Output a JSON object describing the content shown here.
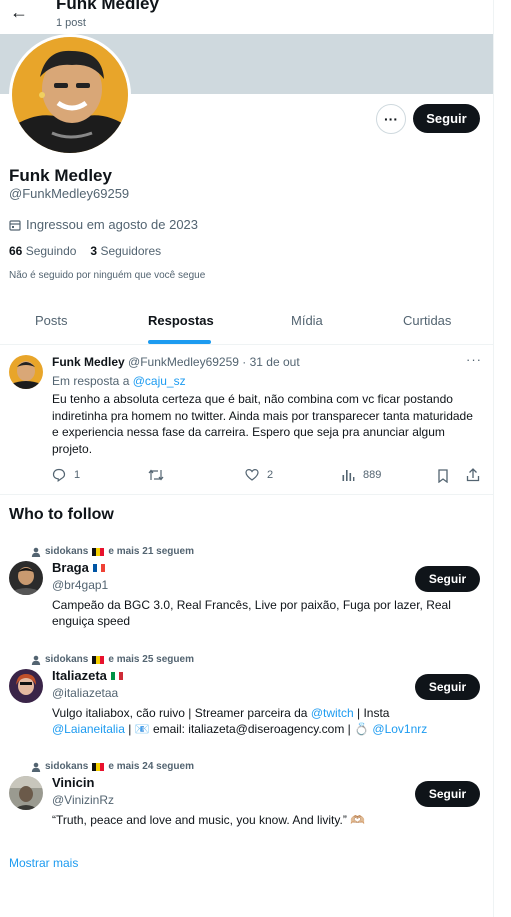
{
  "header": {
    "back_icon": "arrow-left-icon",
    "title": "Funk Medley",
    "subtitle": "1 post"
  },
  "profile": {
    "display_name": "Funk Medley",
    "handle": "@FunkMedley69259",
    "joined": "Ingressou em agosto de 2023",
    "following_count": "66",
    "following_label": "Seguindo",
    "followers_count": "3",
    "followers_label": "Seguidores",
    "not_followed": "Não é seguido por ninguém que você segue",
    "follow_label": "Seguir",
    "more_label": "···"
  },
  "tabs": [
    {
      "label": "Posts"
    },
    {
      "label": "Respostas"
    },
    {
      "label": "Mídia"
    },
    {
      "label": "Curtidas"
    }
  ],
  "tweet": {
    "name": "Funk Medley",
    "handle": "@FunkMedley69259",
    "date": "· 31 de out",
    "reply_prefix": "Em resposta a",
    "reply_to": "@caju_sz",
    "text": "Eu tenho a absoluta certeza que é bait, não combina com vc ficar postando indiretinha pra homem no twitter. Ainda mais por transparecer tanta maturidade e experiencia nessa fase da carreira. Espero que seja pra anunciar algum projeto.",
    "replies": "1",
    "retweets": "",
    "likes": "2",
    "views": "889"
  },
  "who_to_follow": {
    "title": "Who to follow",
    "show_more": "Mostrar mais",
    "follow_label": "Seguir",
    "items": [
      {
        "social_name": "sidokans",
        "social_suffix": "e mais 21 seguem",
        "name": "Braga",
        "handle": "@br4gap1",
        "bio": "Campeão da BGC 3.0, Real Francês, Live por paixão, Fuga por lazer, Real enguiça speed"
      },
      {
        "social_name": "sidokans",
        "social_suffix": "e mais 25 seguem",
        "name": "Italiazeta",
        "handle": "@italiazetaa",
        "bio_1": "Vulgo italiabox, cão ruivo | Streamer parceira da ",
        "bio_link_1": "@twitch",
        "bio_2": " | Insta",
        "bio_link_2": "@Laianeitalia",
        "bio_3": " | 📧 email: italiazeta@diseroagency.com | 💍 ",
        "bio_link_3": "@Lov1nrz"
      },
      {
        "social_name": "sidokans",
        "social_suffix": "e mais 24 seguem",
        "name": "Vinicin",
        "handle": "@VinizinRz",
        "bio": "“Truth, peace and love and music, you know. And livity.” 🫶🏼"
      }
    ]
  }
}
